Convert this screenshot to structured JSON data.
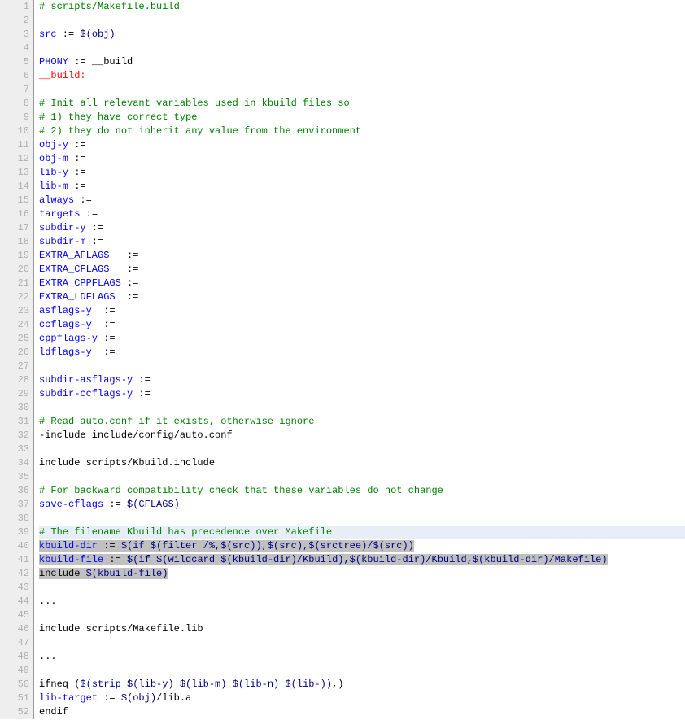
{
  "lines": [
    {
      "n": 1,
      "hl": "",
      "tokens": [
        [
          "c-comment",
          "# scripts/Makefile.build"
        ]
      ]
    },
    {
      "n": 2,
      "hl": "",
      "tokens": [
        [
          "",
          ""
        ]
      ]
    },
    {
      "n": 3,
      "hl": "",
      "tokens": [
        [
          "c-blue",
          "src"
        ],
        [
          "c-black",
          " := "
        ],
        [
          "c-navy",
          "$(obj)"
        ]
      ]
    },
    {
      "n": 4,
      "hl": "",
      "tokens": [
        [
          "",
          ""
        ]
      ]
    },
    {
      "n": 5,
      "hl": "",
      "tokens": [
        [
          "c-blue",
          "PHONY"
        ],
        [
          "c-black",
          " := __build"
        ]
      ]
    },
    {
      "n": 6,
      "hl": "",
      "tokens": [
        [
          "c-red",
          "__build:"
        ]
      ]
    },
    {
      "n": 7,
      "hl": "",
      "tokens": [
        [
          "",
          ""
        ]
      ]
    },
    {
      "n": 8,
      "hl": "",
      "tokens": [
        [
          "c-comment",
          "# Init all relevant variables used in kbuild files so"
        ]
      ]
    },
    {
      "n": 9,
      "hl": "",
      "tokens": [
        [
          "c-comment",
          "# 1) they have correct type"
        ]
      ]
    },
    {
      "n": 10,
      "hl": "",
      "tokens": [
        [
          "c-comment",
          "# 2) they do not inherit any value from the environment"
        ]
      ]
    },
    {
      "n": 11,
      "hl": "",
      "tokens": [
        [
          "c-blue",
          "obj-y"
        ],
        [
          "c-black",
          " :="
        ]
      ]
    },
    {
      "n": 12,
      "hl": "",
      "tokens": [
        [
          "c-blue",
          "obj-m"
        ],
        [
          "c-black",
          " :="
        ]
      ]
    },
    {
      "n": 13,
      "hl": "",
      "tokens": [
        [
          "c-blue",
          "lib-y"
        ],
        [
          "c-black",
          " :="
        ]
      ]
    },
    {
      "n": 14,
      "hl": "",
      "tokens": [
        [
          "c-blue",
          "lib-m"
        ],
        [
          "c-black",
          " :="
        ]
      ]
    },
    {
      "n": 15,
      "hl": "",
      "tokens": [
        [
          "c-blue",
          "always"
        ],
        [
          "c-black",
          " :="
        ]
      ]
    },
    {
      "n": 16,
      "hl": "",
      "tokens": [
        [
          "c-blue",
          "targets"
        ],
        [
          "c-black",
          " :="
        ]
      ]
    },
    {
      "n": 17,
      "hl": "",
      "tokens": [
        [
          "c-blue",
          "subdir-y"
        ],
        [
          "c-black",
          " :="
        ]
      ]
    },
    {
      "n": 18,
      "hl": "",
      "tokens": [
        [
          "c-blue",
          "subdir-m"
        ],
        [
          "c-black",
          " :="
        ]
      ]
    },
    {
      "n": 19,
      "hl": "",
      "tokens": [
        [
          "c-blue",
          "EXTRA_AFLAGS"
        ],
        [
          "c-black",
          "   :="
        ]
      ]
    },
    {
      "n": 20,
      "hl": "",
      "tokens": [
        [
          "c-blue",
          "EXTRA_CFLAGS"
        ],
        [
          "c-black",
          "   :="
        ]
      ]
    },
    {
      "n": 21,
      "hl": "",
      "tokens": [
        [
          "c-blue",
          "EXTRA_CPPFLAGS"
        ],
        [
          "c-black",
          " :="
        ]
      ]
    },
    {
      "n": 22,
      "hl": "",
      "tokens": [
        [
          "c-blue",
          "EXTRA_LDFLAGS"
        ],
        [
          "c-black",
          "  :="
        ]
      ]
    },
    {
      "n": 23,
      "hl": "",
      "tokens": [
        [
          "c-blue",
          "asflags-y"
        ],
        [
          "c-black",
          "  :="
        ]
      ]
    },
    {
      "n": 24,
      "hl": "",
      "tokens": [
        [
          "c-blue",
          "ccflags-y"
        ],
        [
          "c-black",
          "  :="
        ]
      ]
    },
    {
      "n": 25,
      "hl": "",
      "tokens": [
        [
          "c-blue",
          "cppflags-y"
        ],
        [
          "c-black",
          " :="
        ]
      ]
    },
    {
      "n": 26,
      "hl": "",
      "tokens": [
        [
          "c-blue",
          "ldflags-y"
        ],
        [
          "c-black",
          "  :="
        ]
      ]
    },
    {
      "n": 27,
      "hl": "",
      "tokens": [
        [
          "",
          ""
        ]
      ]
    },
    {
      "n": 28,
      "hl": "",
      "tokens": [
        [
          "c-blue",
          "subdir-asflags-y"
        ],
        [
          "c-black",
          " :="
        ]
      ]
    },
    {
      "n": 29,
      "hl": "",
      "tokens": [
        [
          "c-blue",
          "subdir-ccflags-y"
        ],
        [
          "c-black",
          " :="
        ]
      ]
    },
    {
      "n": 30,
      "hl": "",
      "tokens": [
        [
          "",
          ""
        ]
      ]
    },
    {
      "n": 31,
      "hl": "",
      "tokens": [
        [
          "c-comment",
          "# Read auto.conf if it exists, otherwise ignore"
        ]
      ]
    },
    {
      "n": 32,
      "hl": "",
      "tokens": [
        [
          "c-black",
          "-include include/config/auto.conf"
        ]
      ]
    },
    {
      "n": 33,
      "hl": "",
      "tokens": [
        [
          "",
          ""
        ]
      ]
    },
    {
      "n": 34,
      "hl": "",
      "tokens": [
        [
          "c-black",
          "include scripts/Kbuild.include"
        ]
      ]
    },
    {
      "n": 35,
      "hl": "",
      "tokens": [
        [
          "",
          ""
        ]
      ]
    },
    {
      "n": 36,
      "hl": "",
      "tokens": [
        [
          "c-comment",
          "# For backward compatibility check that these variables do not change"
        ]
      ]
    },
    {
      "n": 37,
      "hl": "",
      "tokens": [
        [
          "c-blue",
          "save-cflags"
        ],
        [
          "c-black",
          " := "
        ],
        [
          "c-navy",
          "$(CFLAGS)"
        ]
      ]
    },
    {
      "n": 38,
      "hl": "",
      "tokens": [
        [
          "",
          ""
        ]
      ]
    },
    {
      "n": 39,
      "hl": "light",
      "tokens": [
        [
          "c-comment",
          "# The filename Kbuild has precedence over Makefile"
        ]
      ]
    },
    {
      "n": 40,
      "hl": "dark",
      "tokens": [
        [
          "c-blue sel",
          "kbuild-dir"
        ],
        [
          "c-black sel",
          " := "
        ],
        [
          "c-navy sel",
          "$(if $(filter /%,$(src)),$(src),$(srctree)/$(src))"
        ]
      ]
    },
    {
      "n": 41,
      "hl": "dark",
      "tokens": [
        [
          "c-blue sel",
          "kbuild-file"
        ],
        [
          "c-black sel",
          " := "
        ],
        [
          "c-navy sel",
          "$(if $(wildcard $(kbuild-dir)/Kbuild),$(kbuild-dir)/Kbuild,$(kbuild-dir)/Makefile)"
        ]
      ]
    },
    {
      "n": 42,
      "hl": "dark",
      "tokens": [
        [
          "c-black sel",
          "include "
        ],
        [
          "c-navy sel",
          "$(kbuild-file)"
        ]
      ]
    },
    {
      "n": 43,
      "hl": "",
      "tokens": [
        [
          "",
          ""
        ]
      ]
    },
    {
      "n": 44,
      "hl": "",
      "tokens": [
        [
          "c-black",
          "..."
        ]
      ]
    },
    {
      "n": 45,
      "hl": "",
      "tokens": [
        [
          "",
          ""
        ]
      ]
    },
    {
      "n": 46,
      "hl": "",
      "tokens": [
        [
          "c-black",
          "include scripts/Makefile.lib"
        ]
      ]
    },
    {
      "n": 47,
      "hl": "",
      "tokens": [
        [
          "",
          ""
        ]
      ]
    },
    {
      "n": 48,
      "hl": "",
      "tokens": [
        [
          "c-black",
          "..."
        ]
      ]
    },
    {
      "n": 49,
      "hl": "",
      "tokens": [
        [
          "",
          ""
        ]
      ]
    },
    {
      "n": 50,
      "hl": "",
      "tokens": [
        [
          "c-black",
          "ifneq ("
        ],
        [
          "c-navy",
          "$(strip $(lib-y) $(lib-m) $(lib-n) $(lib-))"
        ],
        [
          "c-black",
          ",)"
        ]
      ]
    },
    {
      "n": 51,
      "hl": "",
      "tokens": [
        [
          "c-blue",
          "lib-target"
        ],
        [
          "c-black",
          " := "
        ],
        [
          "c-navy",
          "$(obj)"
        ],
        [
          "c-black",
          "/lib.a"
        ]
      ]
    },
    {
      "n": 52,
      "hl": "",
      "tokens": [
        [
          "c-black",
          "endif"
        ]
      ]
    }
  ]
}
